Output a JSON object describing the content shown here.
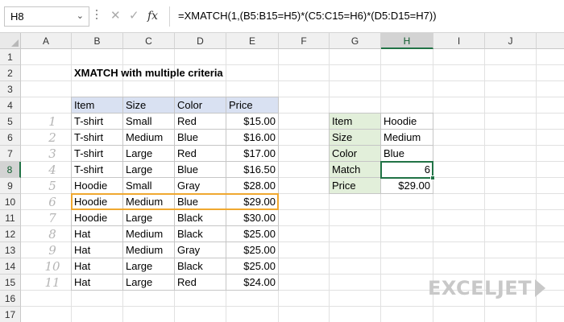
{
  "formula_bar": {
    "name_box": "H8",
    "cancel_icon": "✕",
    "enter_icon": "✓",
    "fx_label": "fx",
    "formula": "=XMATCH(1,(B5:B15=H5)*(C5:C15=H6)*(D5:D15=H7))"
  },
  "columns": [
    "A",
    "B",
    "C",
    "D",
    "E",
    "F",
    "G",
    "H",
    "I",
    "J"
  ],
  "rows": [
    "1",
    "2",
    "3",
    "4",
    "5",
    "6",
    "7",
    "8",
    "9",
    "10",
    "11",
    "12",
    "13",
    "14",
    "15",
    "16",
    "17"
  ],
  "selected_column": "H",
  "selected_row": "8",
  "title": "XMATCH with multiple criteria",
  "table": {
    "headers": [
      "Item",
      "Size",
      "Color",
      "Price"
    ],
    "rows": [
      [
        "T-shirt",
        "Small",
        "Red",
        "$15.00"
      ],
      [
        "T-shirt",
        "Medium",
        "Blue",
        "$16.00"
      ],
      [
        "T-shirt",
        "Large",
        "Red",
        "$17.00"
      ],
      [
        "T-shirt",
        "Large",
        "Blue",
        "$16.50"
      ],
      [
        "Hoodie",
        "Small",
        "Gray",
        "$28.00"
      ],
      [
        "Hoodie",
        "Medium",
        "Blue",
        "$29.00"
      ],
      [
        "Hoodie",
        "Large",
        "Black",
        "$30.00"
      ],
      [
        "Hat",
        "Medium",
        "Black",
        "$25.00"
      ],
      [
        "Hat",
        "Medium",
        "Gray",
        "$25.00"
      ],
      [
        "Hat",
        "Large",
        "Black",
        "$25.00"
      ],
      [
        "Hat",
        "Large",
        "Red",
        "$24.00"
      ]
    ],
    "highlighted_row_index": 5
  },
  "row_numbers": [
    "1",
    "2",
    "3",
    "4",
    "5",
    "6",
    "7",
    "8",
    "9",
    "10",
    "11"
  ],
  "criteria": [
    {
      "label": "Item",
      "value": "Hoodie",
      "numeric": false
    },
    {
      "label": "Size",
      "value": "Medium",
      "numeric": false
    },
    {
      "label": "Color",
      "value": "Blue",
      "numeric": false
    },
    {
      "label": "Match",
      "value": "6",
      "numeric": true
    },
    {
      "label": "Price",
      "value": "$29.00",
      "numeric": true
    }
  ],
  "logo": {
    "text": "EXCELJET"
  },
  "colors": {
    "header_fill": "#d9e1f2",
    "label_fill": "#e2efda",
    "highlight": "#f0a830",
    "selection": "#217346"
  }
}
